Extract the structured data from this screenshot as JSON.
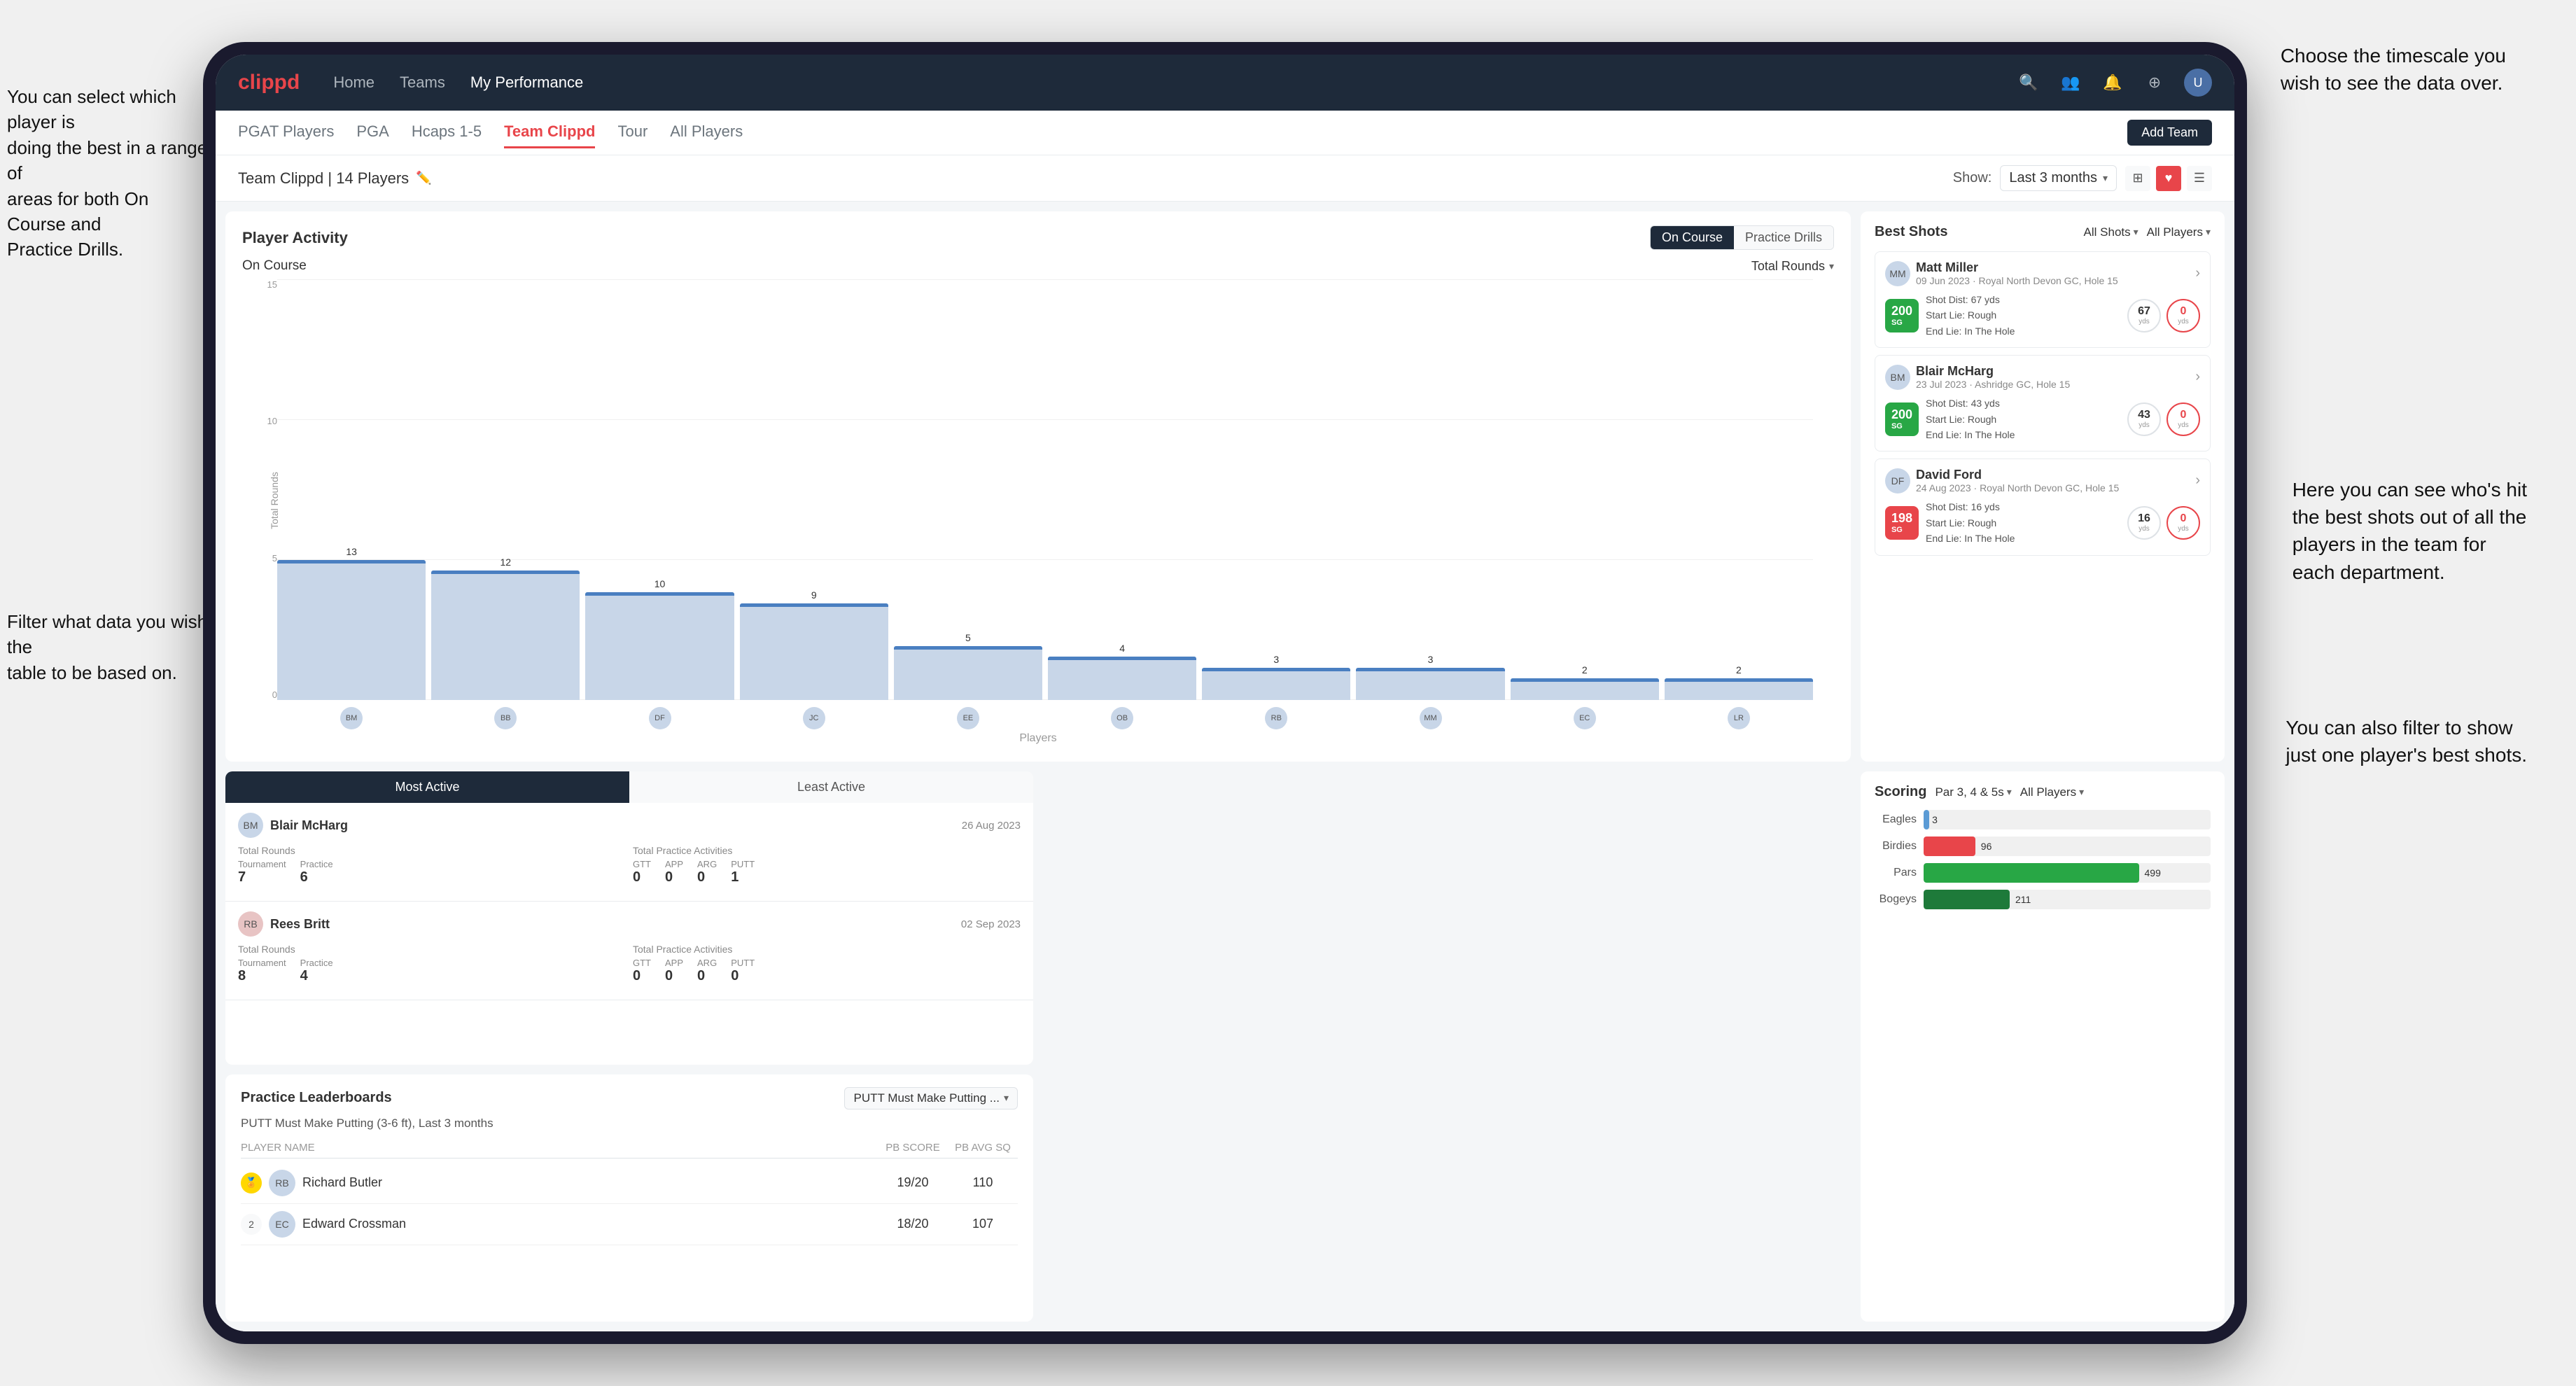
{
  "annotations": {
    "top_right": "Choose the timescale you\nwish to see the data over.",
    "left_top": "You can select which player is\ndoing the best in a range of\nareas for both On Course and\nPractice Drills.",
    "left_bottom": "Filter what data you wish the\ntable to be based on.",
    "right_middle": "Here you can see who's hit\nthe best shots out of all the\nplayers in the team for\neach department.",
    "right_bottom": "You can also filter to show\njust one player's best shots."
  },
  "nav": {
    "logo": "clippd",
    "links": [
      "Home",
      "Teams",
      "My Performance"
    ],
    "active_link": "My Performance"
  },
  "tabs": {
    "items": [
      "PGAT Players",
      "PGA",
      "Hcaps 1-5",
      "Team Clippd",
      "Tour",
      "All Players"
    ],
    "active": "Team Clippd",
    "add_button": "Add Team"
  },
  "team_header": {
    "title": "Team Clippd | 14 Players",
    "show_label": "Show:",
    "time_filter": "Last 3 months",
    "chevron": "▾"
  },
  "player_activity": {
    "title": "Player Activity",
    "toggle_on_course": "On Course",
    "toggle_practice": "Practice Drills",
    "active_toggle": "On Course",
    "section_label": "On Course",
    "dropdown_label": "Total Rounds",
    "y_axis_label": "Total Rounds",
    "x_axis_label": "Players",
    "bars": [
      {
        "name": "B. McHarg",
        "value": 13
      },
      {
        "name": "B. Britt",
        "value": 12
      },
      {
        "name": "D. Ford",
        "value": 10
      },
      {
        "name": "J. Coles",
        "value": 9
      },
      {
        "name": "E. Ebert",
        "value": 5
      },
      {
        "name": "O. Billingham",
        "value": 4
      },
      {
        "name": "R. Butler",
        "value": 3
      },
      {
        "name": "M. Miller",
        "value": 3
      },
      {
        "name": "E. Crossman",
        "value": 2
      },
      {
        "name": "L. Robertson",
        "value": 2
      }
    ],
    "y_ticks": [
      "0",
      "5",
      "10",
      "15"
    ]
  },
  "best_shots": {
    "title": "Best Shots",
    "filter1_label": "All Shots",
    "filter2_label": "All Players",
    "players": [
      {
        "name": "Matt Miller",
        "location": "09 Jun 2023 · Royal North Devon GC, Hole 15",
        "badge": "200",
        "badge_class": "green",
        "badge_sub": "SG",
        "shot_dist": "Shot Dist: 67 yds",
        "start_lie": "Start Lie: Rough",
        "end_lie": "End Lie: In The Hole",
        "stat1_val": "67",
        "stat1_unit": "yds",
        "stat2_val": "0",
        "stat2_unit": "yds",
        "stat2_red": true
      },
      {
        "name": "Blair McHarg",
        "location": "23 Jul 2023 · Ashridge GC, Hole 15",
        "badge": "200",
        "badge_class": "green",
        "badge_sub": "SG",
        "shot_dist": "Shot Dist: 43 yds",
        "start_lie": "Start Lie: Rough",
        "end_lie": "End Lie: In The Hole",
        "stat1_val": "43",
        "stat1_unit": "yds",
        "stat2_val": "0",
        "stat2_unit": "yds",
        "stat2_red": true
      },
      {
        "name": "David Ford",
        "location": "24 Aug 2023 · Royal North Devon GC, Hole 15",
        "badge": "198",
        "badge_class": "red",
        "badge_sub": "SG",
        "shot_dist": "Shot Dist: 16 yds",
        "start_lie": "Start Lie: Rough",
        "end_lie": "End Lie: In The Hole",
        "stat1_val": "16",
        "stat1_unit": "yds",
        "stat2_val": "0",
        "stat2_unit": "yds",
        "stat2_red": true
      }
    ]
  },
  "practice_leaderboards": {
    "title": "Practice Leaderboards",
    "dropdown_label": "PUTT Must Make Putting ...",
    "subtitle": "PUTT Must Make Putting (3-6 ft), Last 3 months",
    "columns": [
      "PLAYER NAME",
      "PB SCORE",
      "PB AVG SQ"
    ],
    "rows": [
      {
        "rank": 1,
        "name": "Richard Butler",
        "pb_score": "19/20",
        "pb_avg_sq": "110"
      },
      {
        "rank": 2,
        "name": "Edward Crossman",
        "pb_score": "18/20",
        "pb_avg_sq": "107"
      }
    ]
  },
  "most_active": {
    "tab_active": "Most Active",
    "tab_inactive": "Least Active",
    "players": [
      {
        "name": "Blair McHarg",
        "date": "26 Aug 2023",
        "total_rounds_label": "Total Rounds",
        "tournament_label": "Tournament",
        "practice_label": "Practice",
        "tournament_val": "7",
        "practice_val": "6",
        "total_practice_label": "Total Practice Activities",
        "gtt_label": "GTT",
        "app_label": "APP",
        "arg_label": "ARG",
        "putt_label": "PUTT",
        "gtt_val": "0",
        "app_val": "0",
        "arg_val": "0",
        "putt_val": "1"
      },
      {
        "name": "Rees Britt",
        "date": "02 Sep 2023",
        "tournament_val": "8",
        "practice_val": "4",
        "gtt_val": "0",
        "app_val": "0",
        "arg_val": "0",
        "putt_val": "0"
      }
    ]
  },
  "scoring": {
    "title": "Scoring",
    "filter1_label": "Par 3, 4 & 5s",
    "filter2_label": "All Players",
    "bars": [
      {
        "label": "Eagles",
        "value": 3,
        "pct": 2,
        "color": "#5b9bd5"
      },
      {
        "label": "Birdies",
        "value": 96,
        "pct": 18,
        "color": "#e8454a"
      },
      {
        "label": "Pars",
        "value": 499,
        "pct": 75,
        "color": "#28a745"
      },
      {
        "label": "Bogeys",
        "value": 211,
        "pct": 30,
        "color": "#ffa500"
      }
    ]
  }
}
